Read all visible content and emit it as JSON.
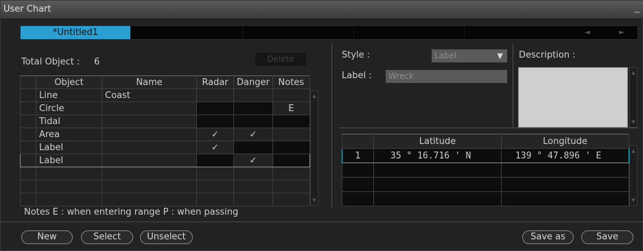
{
  "window": {
    "title": "User Chart",
    "minimize_glyph": "_"
  },
  "tabs": {
    "active_label": "*Untitled1",
    "prev_glyph": "◄",
    "next_glyph": "►"
  },
  "objects": {
    "total_label": "Total Object :",
    "total_value": "6",
    "delete_label": "Delete",
    "headers": {
      "object": "Object",
      "name": "Name",
      "radar": "Radar",
      "danger": "Danger",
      "notes": "Notes"
    },
    "rows": [
      {
        "object": "Line",
        "name": "Coast",
        "radar": "",
        "danger": "",
        "notes": ""
      },
      {
        "object": "Circle",
        "name": "",
        "radar": "",
        "danger": "",
        "notes": "E"
      },
      {
        "object": "Tidal",
        "name": "",
        "radar": "",
        "danger": "",
        "notes": ""
      },
      {
        "object": "Area",
        "name": "",
        "radar": "✓",
        "danger": "✓",
        "notes": ""
      },
      {
        "object": "Label",
        "name": "",
        "radar": "✓",
        "danger": "",
        "notes": ""
      },
      {
        "object": "Label",
        "name": "",
        "radar": "",
        "danger": "✓",
        "notes": ""
      }
    ],
    "legend": "Notes  E : when entering range  P : when passing"
  },
  "properties": {
    "style_label": "Style :",
    "style_value": "Label",
    "label_label": "Label :",
    "label_value": "Wreck",
    "description_label": "Description :"
  },
  "coordinates": {
    "headers": {
      "latitude": "Latitude",
      "longitude": "Longitude"
    },
    "rows": [
      {
        "index": "1",
        "latitude": "35 ° 16.716 ' N",
        "longitude": "139 ° 47.896 ' E"
      }
    ]
  },
  "buttons": {
    "new": "New",
    "select": "Select",
    "unselect": "Unselect",
    "save_as": "Save as",
    "save": "Save"
  },
  "colors": {
    "accent": "#2aa0d2",
    "selection_border": "#33b5cf",
    "background": "#222222"
  }
}
